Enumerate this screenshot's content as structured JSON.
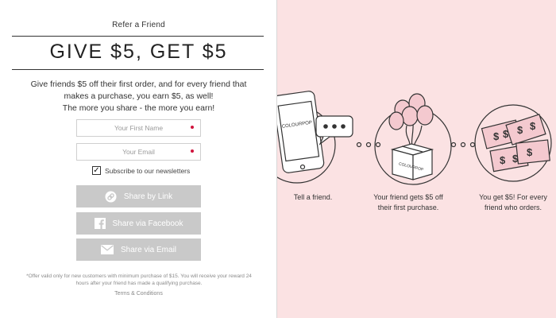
{
  "header": {
    "eyebrow": "Refer a Friend",
    "headline": "GIVE $5, GET $5"
  },
  "description": {
    "line1": "Give friends $5 off their first order, and for every friend that",
    "line2": "makes a purchase, you earn $5, as well!",
    "line3": "The more you share - the more you earn!"
  },
  "form": {
    "first_name_placeholder": "Your First Name",
    "email_placeholder": "Your Email",
    "newsletter_label": "Subscribe to our newsletters",
    "newsletter_checked": true,
    "checkmark": "✓"
  },
  "buttons": {
    "link": {
      "label": "Share by Link",
      "icon": "link-icon"
    },
    "facebook": {
      "label": "Share via Facebook",
      "icon": "facebook-icon"
    },
    "email": {
      "label": "Share via Email",
      "icon": "mail-icon"
    }
  },
  "fine_print": {
    "line1": "*Offer valid only for new customers with minimum purchase of $15. You will receive your reward 24",
    "line2": "hours after your friend has made a qualifying purchase."
  },
  "terms_link": "Terms & Conditions",
  "steps": [
    {
      "line1": "Tell a friend.",
      "line2": ""
    },
    {
      "line1": "Your friend gets $5 off",
      "line2": "their first purchase."
    },
    {
      "line1": "You get $5! For every",
      "line2": "friend who orders."
    }
  ],
  "illustration": {
    "phone_brand": "COLOURPOP",
    "box_brand": "COLOURPOP",
    "dollar_sign": "$"
  },
  "colors": {
    "right_panel_bg": "#fbe2e3",
    "button_bg": "#c9c9c9",
    "required_dot": "#d0143d",
    "money_fill": "#f4c9cf"
  }
}
